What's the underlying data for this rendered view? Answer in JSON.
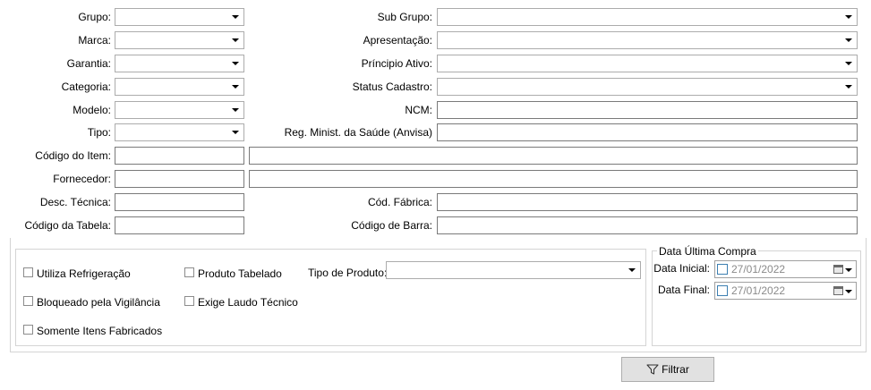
{
  "form": {
    "grupo": {
      "label": "Grupo:",
      "value": ""
    },
    "marca": {
      "label": "Marca:",
      "value": ""
    },
    "garantia": {
      "label": "Garantia:",
      "value": ""
    },
    "categoria": {
      "label": "Categoria:",
      "value": ""
    },
    "modelo": {
      "label": "Modelo:",
      "value": ""
    },
    "tipo": {
      "label": "Tipo:",
      "value": ""
    },
    "codigo_item": {
      "label": "Código do Item:",
      "value": "",
      "desc": ""
    },
    "fornecedor": {
      "label": "Fornecedor:",
      "value": "",
      "desc": ""
    },
    "desc_tecnica": {
      "label": "Desc. Técnica:",
      "value": ""
    },
    "codigo_tabela": {
      "label": "Código da Tabela:",
      "value": ""
    },
    "sub_grupo": {
      "label": "Sub Grupo:",
      "value": ""
    },
    "apresentacao": {
      "label": "Apresentação:",
      "value": ""
    },
    "principio_ativo": {
      "label": "Príncipio Ativo:",
      "value": ""
    },
    "status_cadastro": {
      "label": "Status Cadastro:",
      "value": ""
    },
    "ncm": {
      "label": "NCM:",
      "value": ""
    },
    "reg_anvisa": {
      "label": "Reg. Minist. da Saúde (Anvisa)",
      "value": ""
    },
    "cod_fabrica": {
      "label": "Cód. Fábrica:",
      "value": ""
    },
    "codigo_barra": {
      "label": "Código de Barra:",
      "value": ""
    }
  },
  "options": {
    "utiliza_refrigeracao": {
      "label": "Utiliza Refrigeração",
      "checked": false
    },
    "produto_tabelado": {
      "label": "Produto Tabelado",
      "checked": false
    },
    "bloqueado_vigilancia": {
      "label": "Bloqueado pela Vigilância",
      "checked": false
    },
    "exige_laudo": {
      "label": "Exige Laudo Técnico",
      "checked": false
    },
    "somente_fabricados": {
      "label": "Somente Itens Fabricados",
      "checked": false
    },
    "tipo_produto": {
      "label": "Tipo de Produto:",
      "value": ""
    }
  },
  "data_ultima_compra": {
    "title": "Data Última Compra",
    "data_inicial": {
      "label": "Data Inicial:",
      "value": "27/01/2022",
      "checked": false
    },
    "data_final": {
      "label": "Data Final:",
      "value": "27/01/2022",
      "checked": false
    }
  },
  "actions": {
    "filtrar_label": "Filtrar",
    "filter_icon": "funnel-icon"
  },
  "colors": {
    "border": "#7a7a7a",
    "button_bg": "#e1e1e1",
    "date_check_border": "#3c7fb1",
    "disabled_text": "#8a8a8a"
  }
}
